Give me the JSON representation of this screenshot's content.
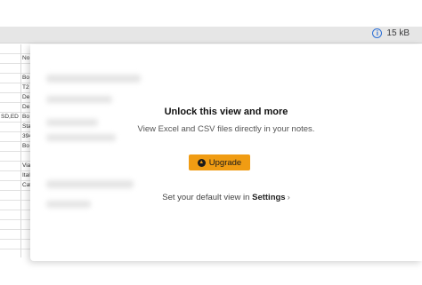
{
  "topbar": {
    "file_size": "15 kB",
    "info_icon": "info-icon"
  },
  "sheet": {
    "col_a": [
      "",
      "",
      "",
      "",
      "",
      "",
      "",
      "SD,ED",
      "",
      "",
      "",
      "",
      "",
      "",
      "",
      "",
      "",
      "",
      "",
      "",
      ""
    ],
    "col_b": [
      "",
      "No",
      "",
      "Bo",
      "T2",
      "De",
      "De",
      "Bo",
      "Sta",
      "394",
      "Bo",
      "",
      "Via",
      "Ital",
      "Cat",
      "",
      "",
      "",
      "",
      "",
      ""
    ]
  },
  "cta": {
    "title": "Unlock this view and more",
    "subtitle": "View Excel and CSV files directly in your notes.",
    "upgrade_label": "Upgrade",
    "upgrade_icon": "arrow-up-icon",
    "settings_prefix": "Set your default view in",
    "settings_link": "Settings",
    "settings_chevron": "›"
  }
}
